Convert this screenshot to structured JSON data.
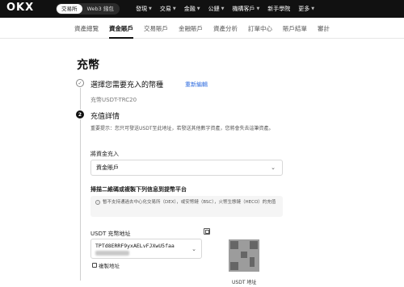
{
  "topbar": {
    "logo": "OKX",
    "mode": {
      "exchange": "交易所",
      "web3": "Web3 錢包"
    },
    "nav": [
      {
        "label": "發現",
        "dropdown": true
      },
      {
        "label": "交易",
        "dropdown": true
      },
      {
        "label": "金融",
        "dropdown": true
      },
      {
        "label": "公鏈",
        "dropdown": true
      },
      {
        "label": "機構客戶",
        "dropdown": true
      },
      {
        "label": "新手學院",
        "dropdown": false
      },
      {
        "label": "更多",
        "dropdown": true
      }
    ]
  },
  "subnav": {
    "tabs": [
      {
        "label": "資產總覽",
        "active": false
      },
      {
        "label": "資金賬戶",
        "active": true
      },
      {
        "label": "交易賬戶",
        "active": false
      },
      {
        "label": "金融賬戶",
        "active": false
      },
      {
        "label": "資產分析",
        "active": false
      },
      {
        "label": "訂單中心",
        "active": false
      },
      {
        "label": "賬戶結單",
        "active": false
      },
      {
        "label": "審計",
        "active": false
      }
    ]
  },
  "page": {
    "title": "充幣"
  },
  "step1": {
    "number": "✓",
    "title": "選擇您需要充入的幣種",
    "reedit": "重新編輯",
    "summary": "充幣USDT-TRC20"
  },
  "step2": {
    "number": "2",
    "title": "充值詳情",
    "notice": "重要提示：您只可發送USDT至此地址，若發送其他數字資產，您將會失去這筆資產。"
  },
  "deposit_to": {
    "label": "將資金充入",
    "value": "資金賬戶"
  },
  "scan_heading": "掃描二維碼或複製下列信息到提幣平台",
  "warning": "暫不支持通過去中心化交易所（DEX），或安幣鏈（BSC），火幣生態鏈（HECO）的充值",
  "address": {
    "label": "USDT 充幣地址",
    "value": "TPTd8ERRF9yxAELvFJXwU5faa",
    "copy_label": "複製地址"
  },
  "qr_label": "USDT 地址"
}
